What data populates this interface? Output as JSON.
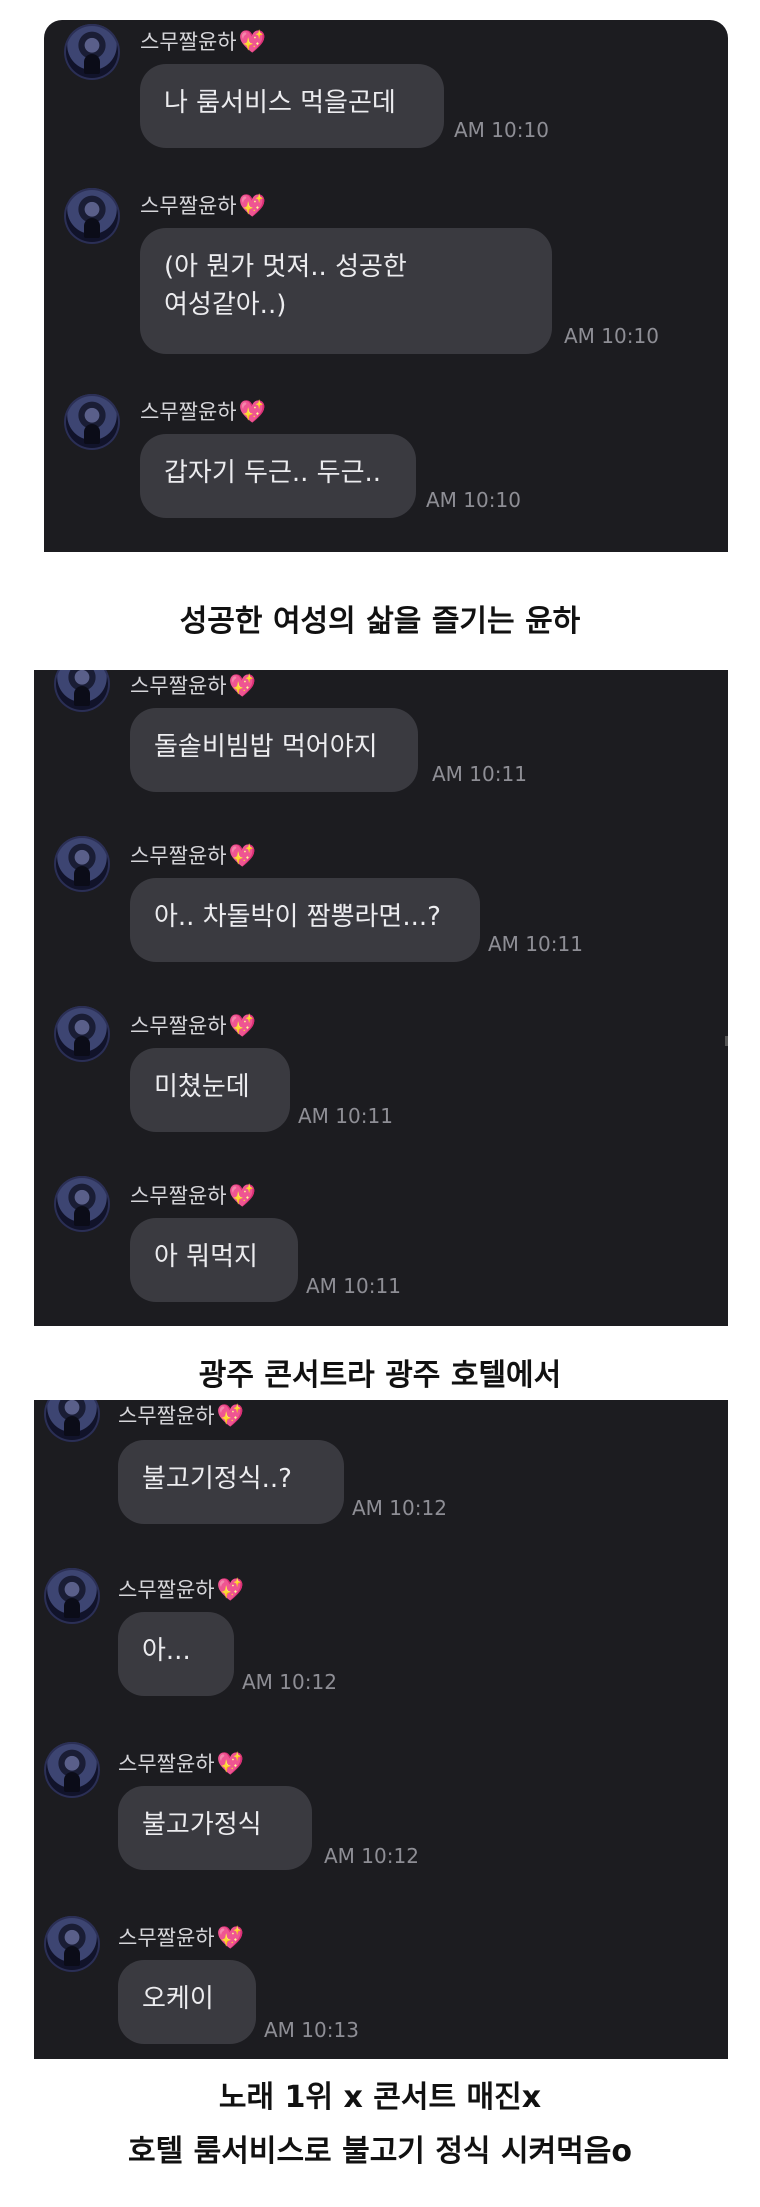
{
  "sender": {
    "name": "스무짤윤하",
    "heart": "💖"
  },
  "panel1": {
    "messages": [
      {
        "text": "나 룸서비스 먹을곤데",
        "time": "AM 10:10"
      },
      {
        "text": "(아 뭔가 멋져.. 성공한\n여성같아..)",
        "time": "AM 10:10"
      },
      {
        "text": "갑자기 두근.. 두근..",
        "time": "AM 10:10"
      }
    ]
  },
  "caption1": "성공한 여성의 삶을 즐기는 윤하",
  "panel2": {
    "messages": [
      {
        "text": "돌솥비빔밥 먹어야지",
        "time": "AM 10:11"
      },
      {
        "text": "아.. 차돌박이 짬뽕라면...?",
        "time": "AM 10:11"
      },
      {
        "text": "미쳤눈데",
        "time": "AM 10:11"
      },
      {
        "text": "아 뭐먹지",
        "time": "AM 10:11"
      }
    ]
  },
  "caption2": "광주 콘서트라 광주 호텔에서",
  "panel3": {
    "messages": [
      {
        "text": "불고기정식..?",
        "time": "AM 10:12"
      },
      {
        "text": "아...",
        "time": "AM 10:12"
      },
      {
        "text": "불고가정식",
        "time": "AM 10:12"
      },
      {
        "text": "오케이",
        "time": "AM 10:13"
      }
    ]
  },
  "caption3": {
    "line1": "노래 1위 x 콘서트 매진x",
    "line2": "호텔 룸서비스로 불고기 정식 시켜먹음o"
  }
}
